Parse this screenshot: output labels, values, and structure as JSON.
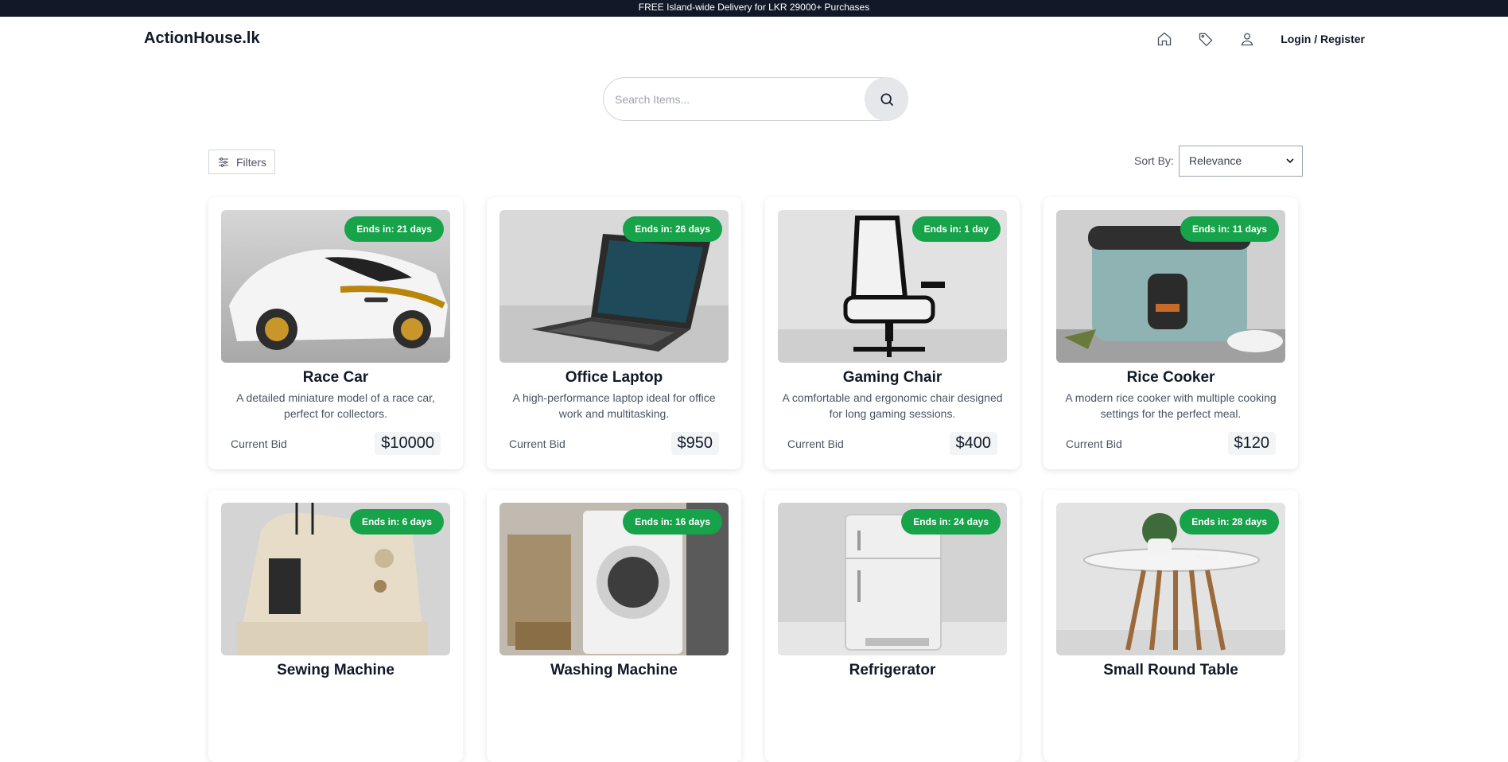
{
  "announcement": "FREE Island-wide Delivery for LKR 29000+ Purchases",
  "header": {
    "logo": "ActionHouse.lk",
    "nav_icons": [
      "home-icon",
      "tag-icon",
      "user-icon"
    ],
    "login_label": "Login / Register"
  },
  "search": {
    "placeholder": "Search Items..."
  },
  "toolbar": {
    "filters_label": "Filters",
    "sort_label": "Sort By:",
    "sort_value": "Relevance"
  },
  "colors": {
    "accent": "#16a34a",
    "dark": "#111827"
  },
  "products": [
    {
      "title": "Race Car",
      "description": "A detailed miniature model of a race car, perfect for collectors.",
      "ends": "Ends in: 21 days",
      "bid_label": "Current Bid",
      "bid": "$10000"
    },
    {
      "title": "Office Laptop",
      "description": "A high-performance laptop ideal for office work and multitasking.",
      "ends": "Ends in: 26 days",
      "bid_label": "Current Bid",
      "bid": "$950"
    },
    {
      "title": "Gaming Chair",
      "description": "A comfortable and ergonomic chair designed for long gaming sessions.",
      "ends": "Ends in: 1 day",
      "bid_label": "Current Bid",
      "bid": "$400"
    },
    {
      "title": "Rice Cooker",
      "description": "A modern rice cooker with multiple cooking settings for the perfect meal.",
      "ends": "Ends in: 11 days",
      "bid_label": "Current Bid",
      "bid": "$120"
    },
    {
      "title": "Sewing Machine",
      "ends": "Ends in: 6 days"
    },
    {
      "title": "Washing Machine",
      "ends": "Ends in: 16 days"
    },
    {
      "title": "Refrigerator",
      "ends": "Ends in: 24 days"
    },
    {
      "title": "Small Round Table",
      "ends": "Ends in: 28 days"
    }
  ]
}
